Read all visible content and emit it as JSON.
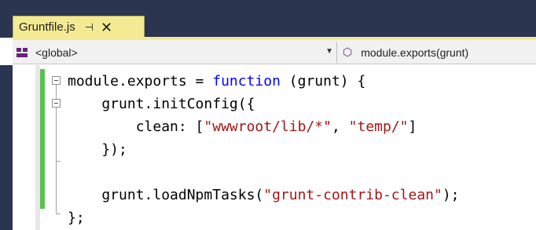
{
  "tab": {
    "title": "Gruntfile.js",
    "pin_glyph": "⊣",
    "close_glyph": "✕"
  },
  "navbar": {
    "scope_label": "<global>",
    "member_label": "module.exports(grunt)",
    "dropdown_glyph": "▼",
    "scope_icon": "class-icon",
    "member_icon": "method-icon"
  },
  "colors": {
    "chrome": "#2b3550",
    "tab_active": "#f4ea94",
    "change_bar": "#57c34e",
    "keyword": "#0000ff",
    "string": "#a31515"
  },
  "code": {
    "lines": [
      {
        "parts": [
          {
            "t": "module.exports = ",
            "c": "plain"
          },
          {
            "t": "function",
            "c": "kw"
          },
          {
            "t": " (grunt) {",
            "c": "plain"
          }
        ]
      },
      {
        "parts": [
          {
            "t": "    grunt.initConfig({",
            "c": "plain"
          }
        ]
      },
      {
        "parts": [
          {
            "t": "        clean: [",
            "c": "plain"
          },
          {
            "t": "\"wwwroot/lib/*\"",
            "c": "str"
          },
          {
            "t": ", ",
            "c": "plain"
          },
          {
            "t": "\"temp/\"",
            "c": "str"
          },
          {
            "t": "]",
            "c": "plain"
          }
        ]
      },
      {
        "parts": [
          {
            "t": "    });",
            "c": "plain"
          }
        ]
      },
      {
        "parts": [
          {
            "t": "",
            "c": "plain"
          }
        ]
      },
      {
        "parts": [
          {
            "t": "    grunt.loadNpmTasks(",
            "c": "plain"
          },
          {
            "t": "\"grunt-contrib-clean\"",
            "c": "str"
          },
          {
            "t": ");",
            "c": "plain"
          }
        ]
      },
      {
        "parts": [
          {
            "t": "};",
            "c": "plain"
          }
        ]
      }
    ]
  }
}
